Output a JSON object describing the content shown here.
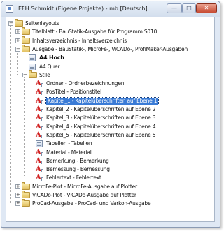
{
  "window": {
    "title": "EFH Schmidt (Eigene Projekte) - mb [Deutsch]",
    "min_label": "—",
    "max_label": "□",
    "close_label": "✕"
  },
  "tree": [
    {
      "id": "seitenlayouts",
      "label": "Seitenlayouts",
      "level": 0,
      "icon": "folder-icon",
      "expander": "−"
    },
    {
      "id": "titelblatt",
      "label": "Titelblatt - BauStatik-Ausgabe für Programm S010",
      "level": 1,
      "icon": "folder-icon",
      "expander": "+"
    },
    {
      "id": "inhaltsverzeichnis",
      "label": "Inhaltsverzeichnis - Inhaltsverzeichnis",
      "level": 1,
      "icon": "folder-icon",
      "expander": "+"
    },
    {
      "id": "ausgabe",
      "label": "Ausgabe - BauStatik-, MicroFe-, ViCADo-, ProfiMaker-Ausgaben",
      "level": 1,
      "icon": "folder-icon",
      "expander": "−"
    },
    {
      "id": "a4hoch",
      "label": "A4 Hoch",
      "level": 2,
      "icon": "document-icon",
      "bold": true
    },
    {
      "id": "a4quer",
      "label": "A4 Quer",
      "level": 2,
      "icon": "document-icon"
    },
    {
      "id": "stile",
      "label": "Stile",
      "level": 2,
      "icon": "folder-icon",
      "expander": "−"
    },
    {
      "id": "ordner",
      "label": "Ordner - Ordnerbezeichnungen",
      "level": 3,
      "icon": "text-style-icon"
    },
    {
      "id": "postitel",
      "label": "PosTitel - Positionstitel",
      "level": 3,
      "icon": "text-style-icon"
    },
    {
      "id": "kapitel1",
      "label": "Kapitel_1 - Kapitelüberschriften auf Ebene 1",
      "level": 3,
      "icon": "text-style-icon",
      "selected": true
    },
    {
      "id": "kapitel2",
      "label": "Kapitel_2 - Kapitelüberschriften auf Ebene 2",
      "level": 3,
      "icon": "text-style-icon"
    },
    {
      "id": "kapitel3",
      "label": "Kapitel_3 - Kapitelüberschriften auf Ebene 3",
      "level": 3,
      "icon": "text-style-icon"
    },
    {
      "id": "kapitel4",
      "label": "Kapitel_4 - Kapitelüberschriften auf Ebene 4",
      "level": 3,
      "icon": "text-style-icon"
    },
    {
      "id": "kapitel5",
      "label": "Kapitel_5 - Kapitelüberschriften auf Ebene 5",
      "level": 3,
      "icon": "text-style-icon"
    },
    {
      "id": "tabellen",
      "label": "Tabellen - Tabellen",
      "level": 3,
      "icon": "table-style-icon"
    },
    {
      "id": "material",
      "label": "Material - Material",
      "level": 3,
      "icon": "text-style-icon"
    },
    {
      "id": "bemerkung",
      "label": "Bemerkung - Bemerkung",
      "level": 3,
      "icon": "text-style-icon"
    },
    {
      "id": "bemessung",
      "label": "Bemessung - Bemessung",
      "level": 3,
      "icon": "text-style-icon"
    },
    {
      "id": "fehlertext",
      "label": "Fehlertext - Fehlertext",
      "level": 3,
      "icon": "text-style-icon"
    },
    {
      "id": "microfeplot",
      "label": "MicroFe-Plot - MicroFe-Ausgabe auf Plotter",
      "level": 1,
      "icon": "folder-icon",
      "expander": "+"
    },
    {
      "id": "vicadoplot",
      "label": "ViCADo-Plot - ViCADo-Ausgabe auf Plotter",
      "level": 1,
      "icon": "folder-icon",
      "expander": "+"
    },
    {
      "id": "procadausgabe",
      "label": "ProCad-Ausgabe - ProCad- und Varkon-Ausgabe",
      "level": 1,
      "icon": "folder-icon",
      "expander": "+"
    }
  ]
}
